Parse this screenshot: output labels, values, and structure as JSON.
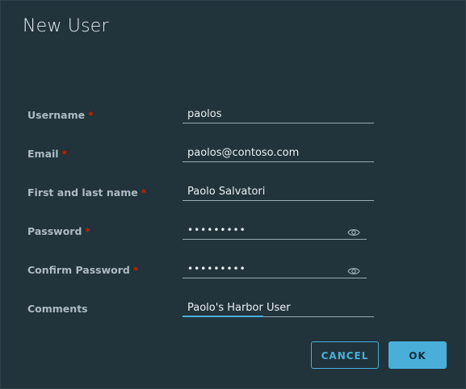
{
  "dialog": {
    "title": "New User",
    "required_marker": "*"
  },
  "fields": {
    "username": {
      "label": "Username",
      "value": "paolos",
      "required": true
    },
    "email": {
      "label": "Email",
      "value": "paolos@contoso.com",
      "required": true
    },
    "fullname": {
      "label": "First and last name",
      "value": "Paolo Salvatori",
      "required": true
    },
    "password": {
      "label": "Password",
      "value": "•••••••••",
      "required": true,
      "icon": "eye-icon"
    },
    "confirm_password": {
      "label": "Confirm Password",
      "value": "•••••••••",
      "required": true,
      "icon": "eye-icon"
    },
    "comments": {
      "label": "Comments",
      "value": "Paolo's Harbor User",
      "required": false
    }
  },
  "buttons": {
    "cancel": "CANCEL",
    "ok": "OK"
  },
  "colors": {
    "background": "#21333b",
    "accent": "#49afd9",
    "required": "#c92100",
    "label": "#adbbc2"
  }
}
